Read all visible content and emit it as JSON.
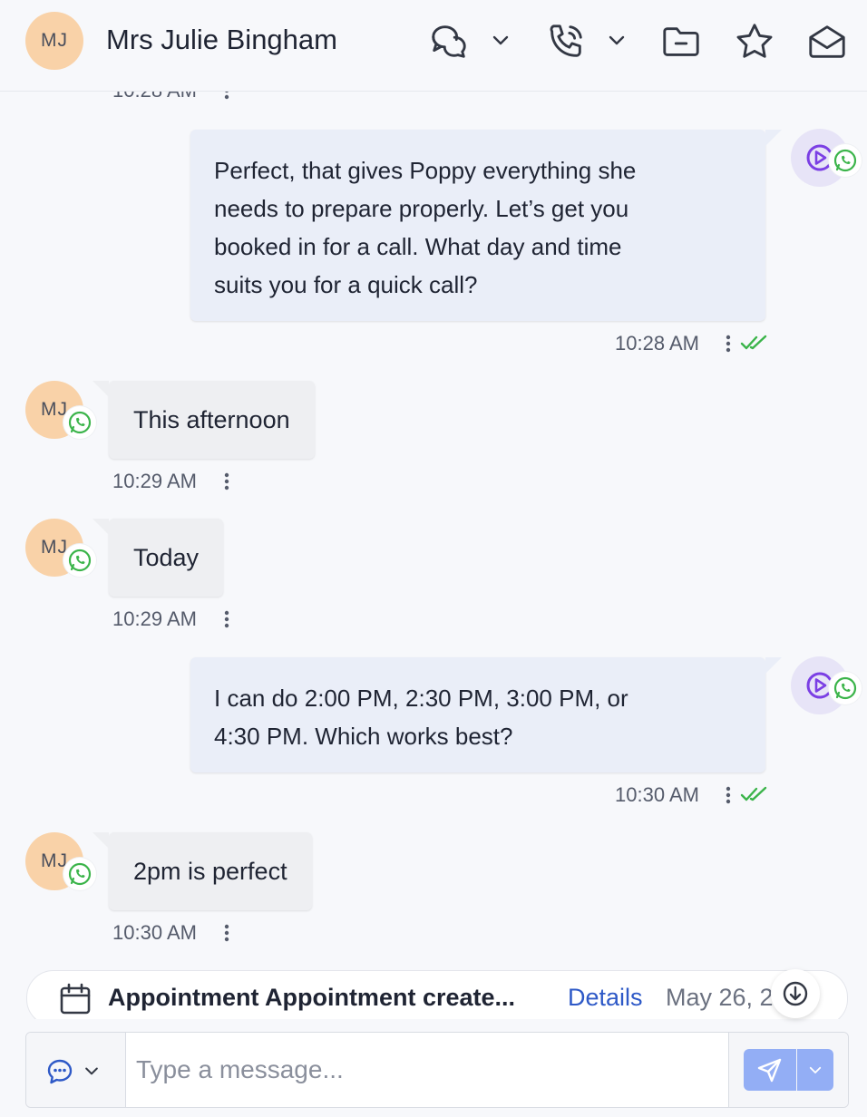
{
  "header": {
    "avatar_initials": "MJ",
    "contact_name": "Mrs Julie Bingham",
    "icons": [
      "chat-bubbles-icon",
      "chevron-down-icon",
      "phone-icon",
      "chevron-down-icon",
      "folder-icon",
      "star-icon",
      "mail-icon"
    ]
  },
  "messages": [
    {
      "direction": "out",
      "time": "10:28 AM",
      "partial": true
    },
    {
      "direction": "out",
      "text_lines": [
        "Perfect, that gives Poppy everything she",
        "needs to prepare properly. Let’s get you",
        "booked in for a call. What day and time",
        "suits you for a quick call?"
      ],
      "time": "10:28 AM",
      "read": true
    },
    {
      "direction": "in",
      "initials": "MJ",
      "text": "This afternoon",
      "time": "10:29 AM"
    },
    {
      "direction": "in",
      "initials": "MJ",
      "text": "Today",
      "time": "10:29 AM"
    },
    {
      "direction": "out",
      "text_lines": [
        "I can do 2:00 PM, 2:30 PM, 3:00 PM, or",
        "4:30 PM. Which works best?"
      ],
      "time": "10:30 AM",
      "read": true
    },
    {
      "direction": "in",
      "initials": "MJ",
      "text": "2pm is perfect",
      "time": "10:30 AM"
    }
  ],
  "appointment": {
    "title": "Appointment Appointment create...",
    "details_label": "Details",
    "date": "May 26, 2"
  },
  "composer": {
    "placeholder": "Type a message...",
    "value": ""
  },
  "colors": {
    "accent": "#2e59c7",
    "whatsapp": "#3bb44a",
    "bot_purple": "#7b3fe4",
    "send_button": "#93aef5",
    "avatar_bg": "#f9d2a8"
  }
}
